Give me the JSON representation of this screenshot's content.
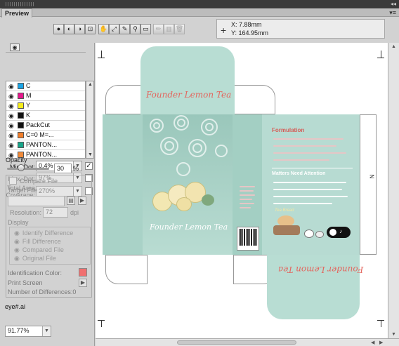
{
  "window": {
    "panel_menu_icon": "panel-menu-icon",
    "tab_label": "Preview"
  },
  "toolbar": {
    "buttons": [
      "view-composite-icon",
      "view-separations-icon",
      "view-overprint-icon",
      "view-zoom-icon",
      "hand-icon",
      "zoom-icon",
      "eyedropper-icon",
      "magnifier-icon",
      "ruler-icon",
      "pencil-icon",
      "trash-icon"
    ]
  },
  "coords": {
    "x_label": "X:",
    "x_value": "7.88mm",
    "y_label": "Y:",
    "y_value": "164.95mm"
  },
  "separations": [
    {
      "label": "C",
      "color": "#1aa5e6"
    },
    {
      "label": "M",
      "color": "#e6178c"
    },
    {
      "label": "Y",
      "color": "#f5ec1a"
    },
    {
      "label": "K",
      "color": "#111111"
    },
    {
      "label": "PackCut",
      "color": "#111111"
    },
    {
      "label": "C=0 M=...",
      "color": "#f07d2a"
    },
    {
      "label": "PANTON...",
      "color": "#17a58a"
    },
    {
      "label": "PANTON...",
      "color": "#f08a3a"
    }
  ],
  "settings": {
    "min_dot_label": "Min. Dot:",
    "min_dot_value": "0.4%",
    "max_dot_label": "Max. Dot:",
    "max_dot_value": "97%",
    "tac_label_1": "Total Area",
    "tac_label_2": "Coverage:",
    "tac_value": "270%",
    "opacity_label": "Opacity",
    "opacity_value": "30",
    "opacity_unit": "%"
  },
  "compare": {
    "compare_file_label": "Compare File",
    "target_file_label": "Target File",
    "resolution_label": "Resolution:",
    "resolution_value": "72",
    "resolution_unit": "dpi",
    "display_label": "Display",
    "display_items": [
      "Identify Difference",
      "Fill Difference",
      "Compared File",
      "Original File"
    ],
    "identification_color_label": "Identification Color:",
    "print_screen_label": "Print Screen",
    "differences_label": "Number of Differences:0"
  },
  "file": {
    "name": "eye#.ai"
  },
  "zoom": {
    "value": "91.77%"
  },
  "artwork": {
    "title": "Founder Lemon Tea",
    "side_label": "Formulation",
    "side_heading": "Matters Need Attention",
    "small_label": "Tea Bread",
    "edge_mark": "N"
  }
}
